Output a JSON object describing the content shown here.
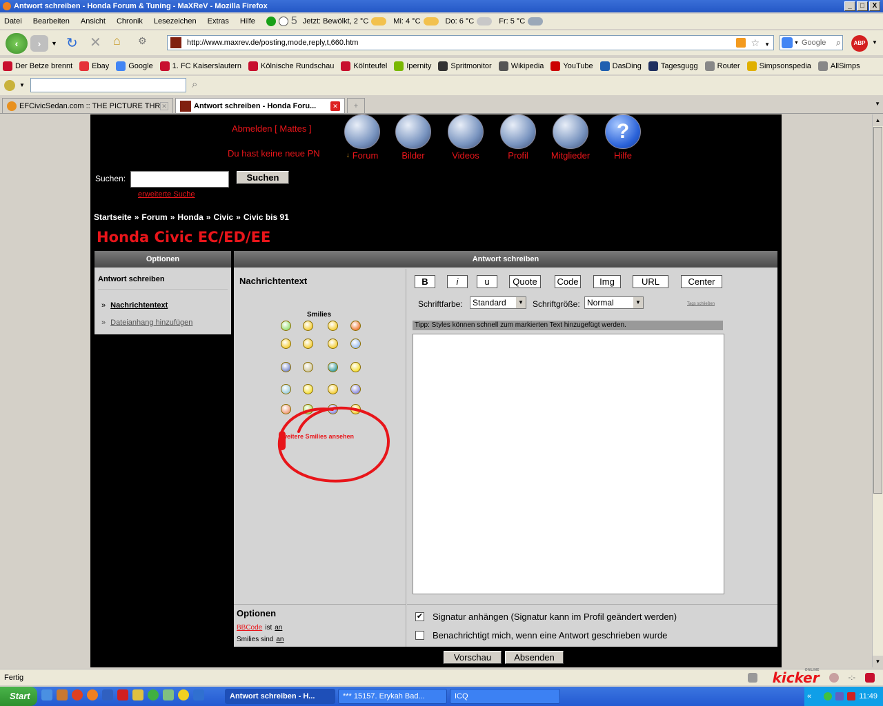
{
  "window": {
    "title": "Antwort schreiben - Honda Forum & Tuning - MaXReV - Mozilla Firefox",
    "controls": [
      "_",
      "□",
      "X"
    ]
  },
  "menu": {
    "items": [
      "Datei",
      "Bearbeiten",
      "Ansicht",
      "Chronik",
      "Lesezeichen",
      "Extras",
      "Hilfe"
    ],
    "counter": "5",
    "weather": [
      "Jetzt: Bewölkt, 2 °C",
      "Mi: 4 °C",
      "Do: 6 °C",
      "Fr: 5 °C"
    ]
  },
  "nav": {
    "url": "http://www.maxrev.de/posting,mode,reply,t,660.htm",
    "search_placeholder": "Google",
    "adblock": "ABP"
  },
  "bookmarks": [
    {
      "label": "Der Betze brennt",
      "color": "#c8102e"
    },
    {
      "label": "Ebay",
      "color": "#e53238"
    },
    {
      "label": "Google",
      "color": "#4285f4"
    },
    {
      "label": "1. FC Kaiserslautern",
      "color": "#c8102e"
    },
    {
      "label": "Kölnische Rundschau",
      "color": "#c8102e"
    },
    {
      "label": "Kölnteufel",
      "color": "#c8102e"
    },
    {
      "label": "Ipernity",
      "color": "#7ab800"
    },
    {
      "label": "Spritmonitor",
      "color": "#333333"
    },
    {
      "label": "Wikipedia",
      "color": "#555555"
    },
    {
      "label": "YouTube",
      "color": "#cc0000"
    },
    {
      "label": "DasDing",
      "color": "#2060b0"
    },
    {
      "label": "Tagesgugg",
      "color": "#203060"
    },
    {
      "label": "Router",
      "color": "#888888"
    },
    {
      "label": "Simpsonspedia",
      "color": "#e0b000"
    },
    {
      "label": "AllSimps",
      "color": "#888888"
    }
  ],
  "tabs": [
    {
      "label": "EFCivicSedan.com :: THE PICTURE THR...",
      "active": false
    },
    {
      "label": "Antwort schreiben - Honda Foru...",
      "active": true
    }
  ],
  "site": {
    "logout": "Abmelden [ Mattes ]",
    "pm": "Du hast keine neue PN",
    "nav": [
      "Forum",
      "Bilder",
      "Videos",
      "Profil",
      "Mitglieder",
      "Hilfe"
    ],
    "forum_arrow": "↓",
    "help_glyph": "?",
    "search_label": "Suchen:",
    "search_button": "Suchen",
    "advanced_search": "erweiterte Suche",
    "breadcrumb": [
      "Startseite",
      "Forum",
      "Honda",
      "Civic",
      "Civic bis 91"
    ],
    "breadcrumb_sep": "»",
    "forum_title": "Honda Civic EC/ED/EE"
  },
  "options_panel": {
    "header": "Optionen",
    "subtitle": "Antwort schreiben",
    "links": [
      "Nachrichtentext",
      "Dateianhang hinzufügen"
    ],
    "link_markers": [
      "»",
      "»"
    ]
  },
  "reply": {
    "header": "Antwort schreiben",
    "message_label": "Nachrichtentext",
    "smilies_label": "Smilies",
    "more_smilies": "weitere Smilies ansehen",
    "format_buttons": [
      "B",
      "i",
      "u",
      "Quote",
      "Code",
      "Img",
      "URL",
      "Center"
    ],
    "font_color_label": "Schriftfarbe:",
    "font_color_value": "Standard",
    "font_size_label": "Schriftgröße:",
    "font_size_value": "Normal",
    "close_tags": "Tags schließen",
    "tip": "Tipp: Styles können schnell zum markierten Text hinzugefügt werden.",
    "message_text": ""
  },
  "bottom_options": {
    "title": "Optionen",
    "bbcode_link": "BBCode",
    "bbcode_text": "ist",
    "bbcode_state": "an",
    "smilies_text": "Smilies sind",
    "smilies_state": "an",
    "signature": "Signatur anhängen (Signatur kann im Profil geändert werden)",
    "signature_checked": true,
    "notify": "Benachrichtigt mich, wenn eine Antwort geschrieben wurde",
    "notify_checked": false
  },
  "actions": {
    "preview": "Vorschau",
    "submit": "Absenden"
  },
  "status": {
    "text": "Fertig",
    "kicker": "kicker",
    "kicker_sub": "ONLINE",
    "dash": "-:-"
  },
  "taskbar": {
    "start": "Start",
    "tasks": [
      "Antwort schreiben - H...",
      "*** 15157. Erykah Bad...",
      "ICQ"
    ],
    "tray_prefix": "«",
    "time": "11:49"
  },
  "colors": {
    "accent_red": "#e8151a",
    "page_black": "#000000",
    "panel_gray": "#d4d4d4"
  }
}
